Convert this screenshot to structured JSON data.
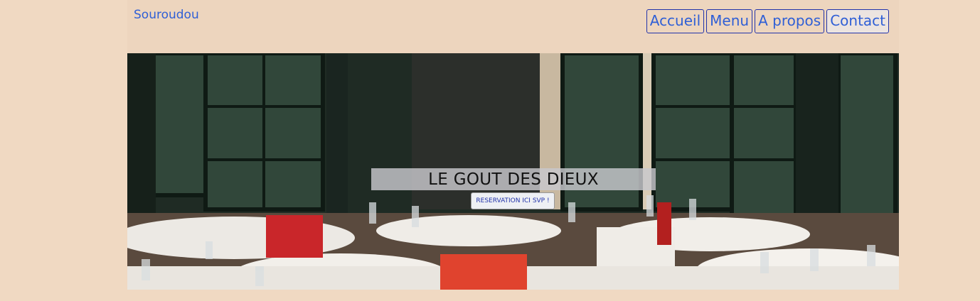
{
  "navbar": {
    "brand": "Souroudou",
    "links": [
      "Accueil",
      "Menu",
      "A propos",
      "Contact"
    ]
  },
  "hero": {
    "title": "LE GOUT DES DIEUX",
    "button_label": "RESERVATION ICI SVP !",
    "image_description": "restaurant terrace with set tables"
  },
  "colors": {
    "page_background": "#f0d9c2",
    "navbar_background": "#edd5be",
    "link_color": "#2f5fd6",
    "link_border": "#2233aa"
  }
}
